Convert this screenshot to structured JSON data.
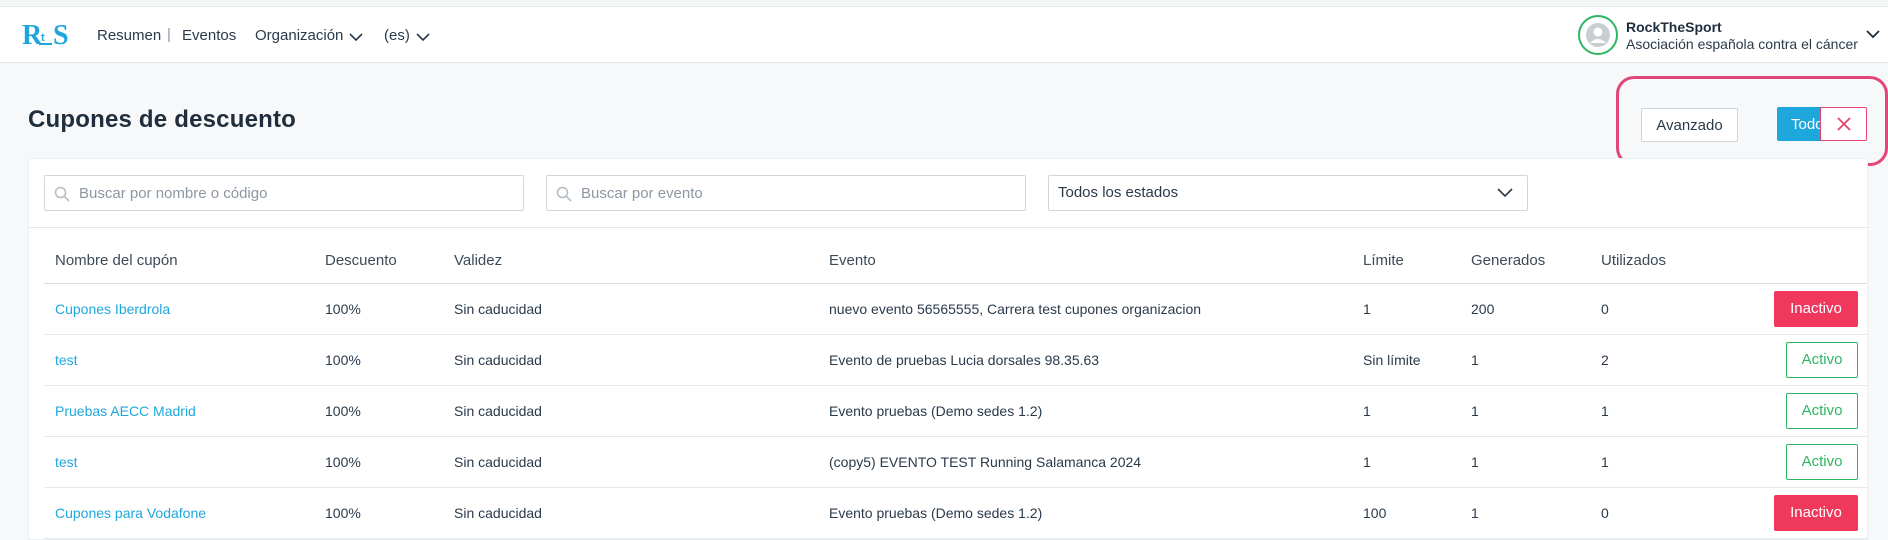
{
  "nav": {
    "logo_text": "RtS",
    "links": [
      "Resumen",
      "Eventos",
      "Organización",
      "(es)"
    ],
    "separator": "|"
  },
  "user": {
    "name": "RockTheSport",
    "organization": "Asociación española contra el cáncer"
  },
  "page": {
    "title": "Cupones de descuento"
  },
  "actions": {
    "advanced_label": "Avanzado",
    "all_label": "Todos",
    "close_icon": "close-icon"
  },
  "filters": {
    "name_placeholder": "Buscar por nombre o código",
    "event_placeholder": "Buscar por evento",
    "status_value": "Todos los estados"
  },
  "table": {
    "headers": [
      "Nombre del cupón",
      "Descuento",
      "Validez",
      "Evento",
      "Límite",
      "Generados",
      "Utilizados"
    ],
    "rows": [
      {
        "name": "Cupones Iberdrola",
        "discount": "100%",
        "validity": "Sin caducidad",
        "event": "nuevo evento 56565555, Carrera test cupones organizacion",
        "limit": "1",
        "generated": "200",
        "used": "0",
        "status": "Inactivo"
      },
      {
        "name": "test",
        "discount": "100%",
        "validity": "Sin caducidad",
        "event": "Evento de pruebas Lucia dorsales 98.35.63",
        "limit": "Sin límite",
        "generated": "1",
        "used": "2",
        "status": "Activo"
      },
      {
        "name": "Pruebas AECC Madrid",
        "discount": "100%",
        "validity": "Sin caducidad",
        "event": "Evento pruebas (Demo sedes 1.2)",
        "limit": "1",
        "generated": "1",
        "used": "1",
        "status": "Activo"
      },
      {
        "name": "test",
        "discount": "100%",
        "validity": "Sin caducidad",
        "event": "(copy5) EVENTO TEST Running Salamanca 2024",
        "limit": "1",
        "generated": "1",
        "used": "1",
        "status": "Activo"
      },
      {
        "name": "Cupones para Vodafone",
        "discount": "100%",
        "validity": "Sin caducidad",
        "event": "Evento pruebas (Demo sedes 1.2)",
        "limit": "100",
        "generated": "1",
        "used": "0",
        "status": "Inactivo"
      }
    ]
  },
  "colors": {
    "brand": "#1ea7dc",
    "active": "#2fb563",
    "inactive": "#f0375c",
    "highlight": "#e2457a"
  }
}
